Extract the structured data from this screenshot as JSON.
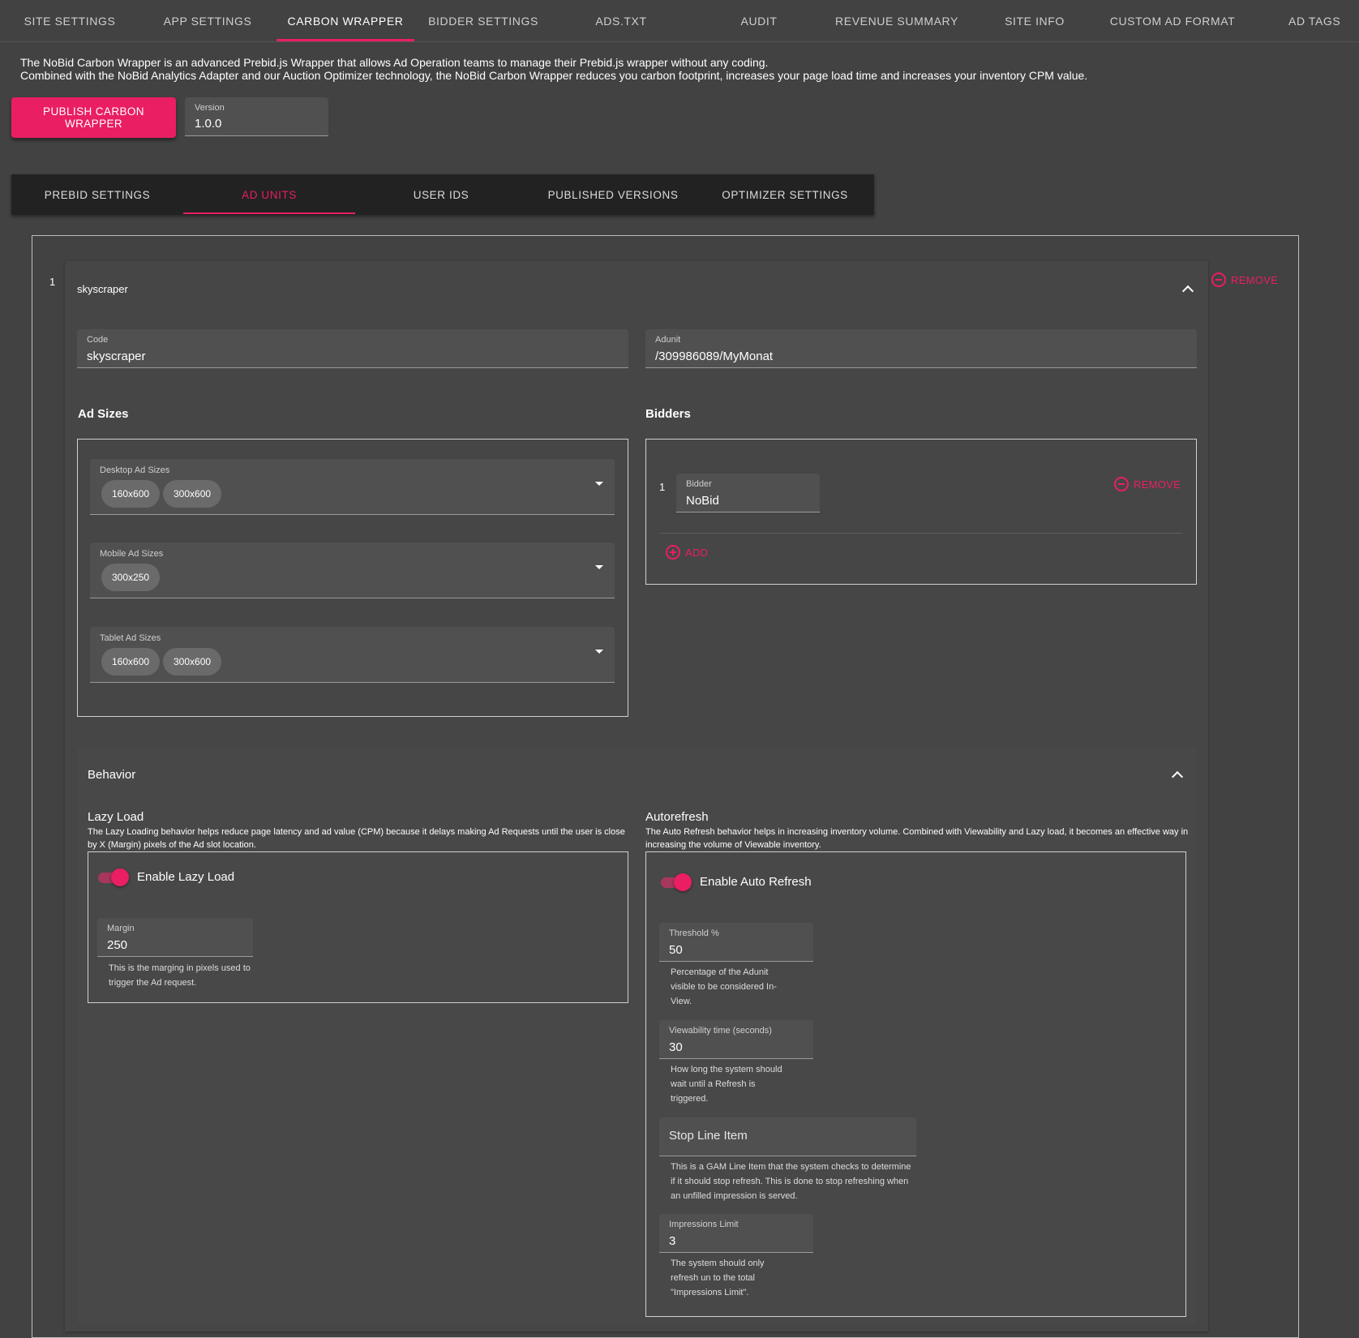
{
  "top_tabs": [
    "SITE SETTINGS",
    "APP SETTINGS",
    "CARBON WRAPPER",
    "BIDDER SETTINGS",
    "ADS.TXT",
    "AUDIT",
    "REVENUE SUMMARY",
    "SITE INFO",
    "CUSTOM AD FORMAT",
    "AD TAGS"
  ],
  "top_active": "CARBON WRAPPER",
  "intro": {
    "line1": "The NoBid Carbon Wrapper is an advanced Prebid.js Wrapper that allows Ad Operation teams to manage their Prebid.js wrapper without any coding.",
    "line2": "Combined with the NoBid Analytics Adapter and our Auction Optimizer technology, the NoBid Carbon Wrapper reduces you carbon footprint, increases your page load time and increases your inventory CPM value."
  },
  "publish_label": "PUBLISH CARBON WRAPPER",
  "version": {
    "label": "Version",
    "value": "1.0.0"
  },
  "sub_tabs": [
    "PREBID SETTINGS",
    "AD UNITS",
    "USER IDS",
    "PUBLISHED VERSIONS",
    "OPTIMIZER SETTINGS"
  ],
  "sub_active": "AD UNITS",
  "ad_unit": {
    "index": "1",
    "name": "skyscraper",
    "remove_label": "REMOVE",
    "code": {
      "label": "Code",
      "value": "skyscraper"
    },
    "adunit": {
      "label": "Adunit",
      "value": "/309986089/MyMonat"
    },
    "ad_sizes_title": "Ad Sizes",
    "desktop": {
      "label": "Desktop Ad Sizes",
      "chips": [
        "160x600",
        "300x600"
      ]
    },
    "mobile": {
      "label": "Mobile Ad Sizes",
      "chips": [
        "300x250"
      ]
    },
    "tablet": {
      "label": "Tablet Ad Sizes",
      "chips": [
        "160x600",
        "300x600"
      ]
    },
    "bidders_title": "Bidders",
    "bidder": {
      "index": "1",
      "label": "Bidder",
      "value": "NoBid",
      "remove_label": "REMOVE"
    },
    "add_label": "ADD"
  },
  "behavior": {
    "title": "Behavior",
    "lazy": {
      "title": "Lazy Load",
      "desc": "The Lazy Loading behavior helps reduce page latency and ad value (CPM) because it delays making Ad Requests until the user is close by X (Margin) pixels of the Ad slot location.",
      "toggle_label": "Enable Lazy Load",
      "enabled": true,
      "margin": {
        "label": "Margin",
        "value": "250",
        "help": "This is the marging in pixels used to trigger the Ad request."
      }
    },
    "auto": {
      "title": "Autorefresh",
      "desc": "The Auto Refresh behavior helps in increasing inventory volume. Combined with Viewability and Lazy load, it becomes an effective way in increasing the volume of Viewable inventory.",
      "toggle_label": "Enable Auto Refresh",
      "enabled": true,
      "threshold": {
        "label": "Threshold %",
        "value": "50",
        "help": "Percentage of the Adunit visible to be considered In-View."
      },
      "viewability": {
        "label": "Viewability time (seconds)",
        "value": "30",
        "help": "How long the system should wait until a Refresh is triggered."
      },
      "stop_line": {
        "placeholder": "Stop Line Item",
        "help": "This is a GAM Line Item that the system checks to determine if it should stop refresh. This is done to stop refreshing when an unfilled impression is served."
      },
      "impressions": {
        "label": "Impressions Limit",
        "value": "3",
        "help": "The system should only refresh un to the total \"Impressions Limit\"."
      }
    }
  },
  "colors": {
    "accent": "#e91e63",
    "background": "#424242",
    "subnav": "#222222"
  }
}
